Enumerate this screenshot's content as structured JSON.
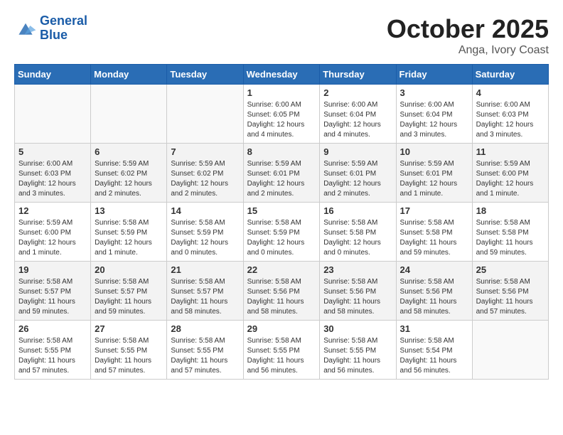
{
  "header": {
    "logo_line1": "General",
    "logo_line2": "Blue",
    "month": "October 2025",
    "location": "Anga, Ivory Coast"
  },
  "days_of_week": [
    "Sunday",
    "Monday",
    "Tuesday",
    "Wednesday",
    "Thursday",
    "Friday",
    "Saturday"
  ],
  "weeks": [
    [
      {
        "day": "",
        "content": ""
      },
      {
        "day": "",
        "content": ""
      },
      {
        "day": "",
        "content": ""
      },
      {
        "day": "1",
        "content": "Sunrise: 6:00 AM\nSunset: 6:05 PM\nDaylight: 12 hours\nand 4 minutes."
      },
      {
        "day": "2",
        "content": "Sunrise: 6:00 AM\nSunset: 6:04 PM\nDaylight: 12 hours\nand 4 minutes."
      },
      {
        "day": "3",
        "content": "Sunrise: 6:00 AM\nSunset: 6:04 PM\nDaylight: 12 hours\nand 3 minutes."
      },
      {
        "day": "4",
        "content": "Sunrise: 6:00 AM\nSunset: 6:03 PM\nDaylight: 12 hours\nand 3 minutes."
      }
    ],
    [
      {
        "day": "5",
        "content": "Sunrise: 6:00 AM\nSunset: 6:03 PM\nDaylight: 12 hours\nand 3 minutes."
      },
      {
        "day": "6",
        "content": "Sunrise: 5:59 AM\nSunset: 6:02 PM\nDaylight: 12 hours\nand 2 minutes."
      },
      {
        "day": "7",
        "content": "Sunrise: 5:59 AM\nSunset: 6:02 PM\nDaylight: 12 hours\nand 2 minutes."
      },
      {
        "day": "8",
        "content": "Sunrise: 5:59 AM\nSunset: 6:01 PM\nDaylight: 12 hours\nand 2 minutes."
      },
      {
        "day": "9",
        "content": "Sunrise: 5:59 AM\nSunset: 6:01 PM\nDaylight: 12 hours\nand 2 minutes."
      },
      {
        "day": "10",
        "content": "Sunrise: 5:59 AM\nSunset: 6:01 PM\nDaylight: 12 hours\nand 1 minute."
      },
      {
        "day": "11",
        "content": "Sunrise: 5:59 AM\nSunset: 6:00 PM\nDaylight: 12 hours\nand 1 minute."
      }
    ],
    [
      {
        "day": "12",
        "content": "Sunrise: 5:59 AM\nSunset: 6:00 PM\nDaylight: 12 hours\nand 1 minute."
      },
      {
        "day": "13",
        "content": "Sunrise: 5:58 AM\nSunset: 5:59 PM\nDaylight: 12 hours\nand 1 minute."
      },
      {
        "day": "14",
        "content": "Sunrise: 5:58 AM\nSunset: 5:59 PM\nDaylight: 12 hours\nand 0 minutes."
      },
      {
        "day": "15",
        "content": "Sunrise: 5:58 AM\nSunset: 5:59 PM\nDaylight: 12 hours\nand 0 minutes."
      },
      {
        "day": "16",
        "content": "Sunrise: 5:58 AM\nSunset: 5:58 PM\nDaylight: 12 hours\nand 0 minutes."
      },
      {
        "day": "17",
        "content": "Sunrise: 5:58 AM\nSunset: 5:58 PM\nDaylight: 11 hours\nand 59 minutes."
      },
      {
        "day": "18",
        "content": "Sunrise: 5:58 AM\nSunset: 5:58 PM\nDaylight: 11 hours\nand 59 minutes."
      }
    ],
    [
      {
        "day": "19",
        "content": "Sunrise: 5:58 AM\nSunset: 5:57 PM\nDaylight: 11 hours\nand 59 minutes."
      },
      {
        "day": "20",
        "content": "Sunrise: 5:58 AM\nSunset: 5:57 PM\nDaylight: 11 hours\nand 59 minutes."
      },
      {
        "day": "21",
        "content": "Sunrise: 5:58 AM\nSunset: 5:57 PM\nDaylight: 11 hours\nand 58 minutes."
      },
      {
        "day": "22",
        "content": "Sunrise: 5:58 AM\nSunset: 5:56 PM\nDaylight: 11 hours\nand 58 minutes."
      },
      {
        "day": "23",
        "content": "Sunrise: 5:58 AM\nSunset: 5:56 PM\nDaylight: 11 hours\nand 58 minutes."
      },
      {
        "day": "24",
        "content": "Sunrise: 5:58 AM\nSunset: 5:56 PM\nDaylight: 11 hours\nand 58 minutes."
      },
      {
        "day": "25",
        "content": "Sunrise: 5:58 AM\nSunset: 5:56 PM\nDaylight: 11 hours\nand 57 minutes."
      }
    ],
    [
      {
        "day": "26",
        "content": "Sunrise: 5:58 AM\nSunset: 5:55 PM\nDaylight: 11 hours\nand 57 minutes."
      },
      {
        "day": "27",
        "content": "Sunrise: 5:58 AM\nSunset: 5:55 PM\nDaylight: 11 hours\nand 57 minutes."
      },
      {
        "day": "28",
        "content": "Sunrise: 5:58 AM\nSunset: 5:55 PM\nDaylight: 11 hours\nand 57 minutes."
      },
      {
        "day": "29",
        "content": "Sunrise: 5:58 AM\nSunset: 5:55 PM\nDaylight: 11 hours\nand 56 minutes."
      },
      {
        "day": "30",
        "content": "Sunrise: 5:58 AM\nSunset: 5:55 PM\nDaylight: 11 hours\nand 56 minutes."
      },
      {
        "day": "31",
        "content": "Sunrise: 5:58 AM\nSunset: 5:54 PM\nDaylight: 11 hours\nand 56 minutes."
      },
      {
        "day": "",
        "content": ""
      }
    ]
  ]
}
